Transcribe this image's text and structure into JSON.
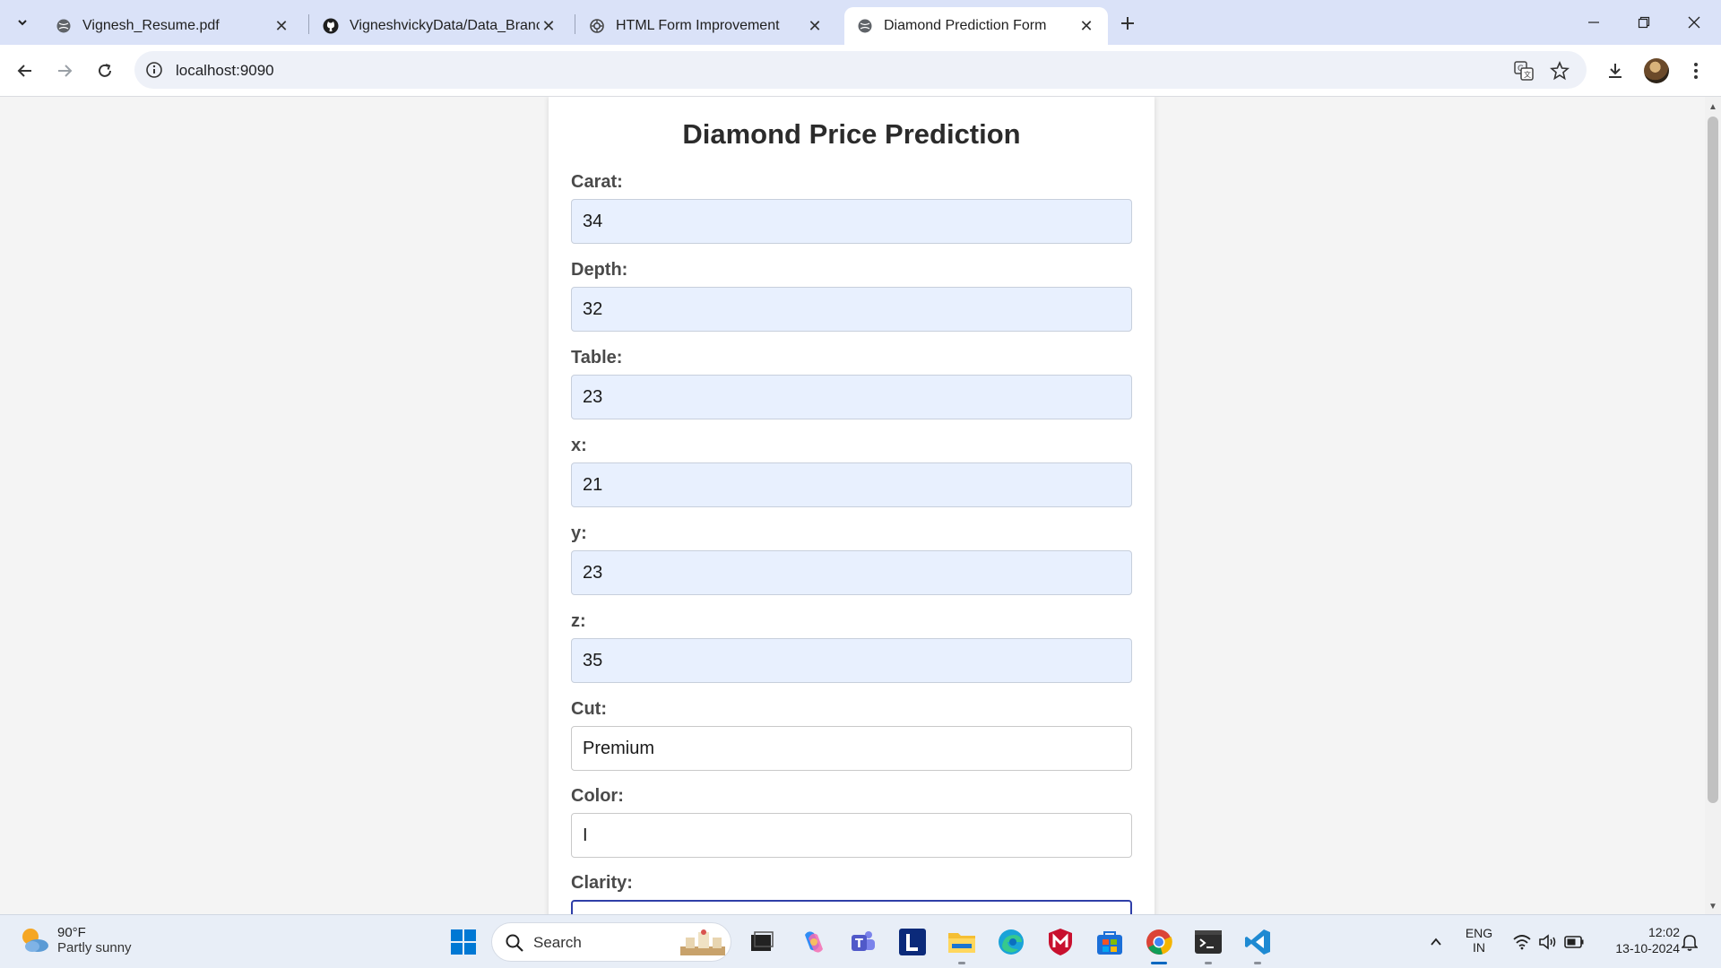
{
  "browser": {
    "tabs": [
      {
        "title": "Vignesh_Resume.pdf",
        "icon": "globe-icon",
        "active": false
      },
      {
        "title": "VigneshvickyData/Data_Branching",
        "icon": "github-icon",
        "active": false
      },
      {
        "title": "HTML Form Improvement",
        "icon": "openai-icon",
        "active": false
      },
      {
        "title": "Diamond Prediction Form",
        "icon": "globe-icon",
        "active": true
      }
    ],
    "url": "localhost:9090"
  },
  "form": {
    "title": "Diamond Price Prediction",
    "fields": [
      {
        "label": "Carat:",
        "value": "34"
      },
      {
        "label": "Depth:",
        "value": "32"
      },
      {
        "label": "Table:",
        "value": "23"
      },
      {
        "label": "x:",
        "value": "21"
      },
      {
        "label": "y:",
        "value": "23"
      },
      {
        "label": "z:",
        "value": "35"
      },
      {
        "label": "Cut:",
        "value": "Premium"
      },
      {
        "label": "Color:",
        "value": "I"
      },
      {
        "label": "Clarity:",
        "value": ""
      }
    ]
  },
  "taskbar": {
    "weather_temp": "90°F",
    "weather_desc": "Partly sunny",
    "search_label": "Search",
    "lang_top": "ENG",
    "lang_bottom": "IN",
    "time": "12:02",
    "date": "13-10-2024"
  },
  "colors": {
    "tabstrip": "#dae2f8",
    "autofill_bg": "#e8f0fe",
    "focus_border": "#2f3fa8",
    "windows_blue": "#0067c0"
  }
}
